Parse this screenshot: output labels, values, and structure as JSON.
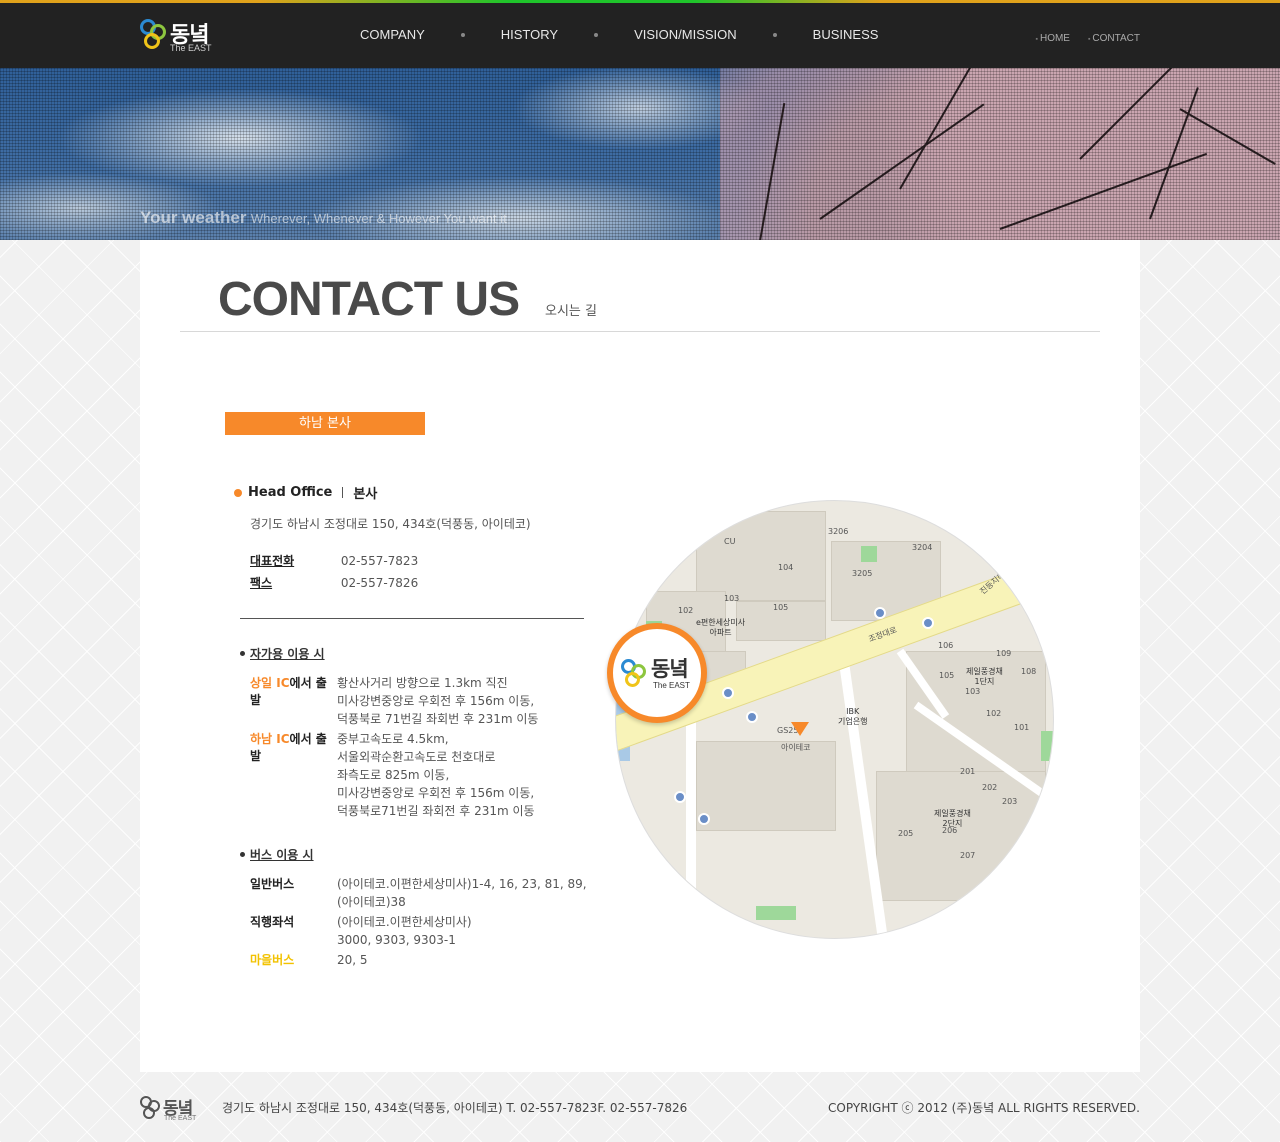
{
  "header": {
    "logo_kr": "동녘",
    "logo_en": "The EAST",
    "nav": [
      "COMPANY",
      "HISTORY",
      "VISION/MISSION",
      "BUSINESS"
    ],
    "util_nav": [
      "HOME",
      "CONTACT"
    ]
  },
  "banner": {
    "slogan_bold": "Your weather",
    "slogan_rest": "Wherever, Whenever & However You want it"
  },
  "page": {
    "title": "CONTACT US",
    "subtitle": "오시는 길",
    "office_tab": "하남 본사"
  },
  "head_office": {
    "title_en": "Head Office",
    "title_kr": "본사",
    "address": "경기도 하남시 조정대로 150, 434호(덕풍동, 아이테코)",
    "phone_label": "대표전화",
    "phone": "02-557-7823",
    "fax_label": "팩스",
    "fax": "02-557-7826"
  },
  "car": {
    "heading": "자가용 이용 시",
    "routes": [
      {
        "label_hl": "상일 IC",
        "label_rest": "에서 출발",
        "lines": [
          "황산사거리 방향으로 1.3km 직진",
          "미사강변중앙로 우회전 후 156m 이동,",
          "덕풍북로 71번길 좌회번 후 231m 이동"
        ]
      },
      {
        "label_hl": "하남 IC",
        "label_rest": "에서 출발",
        "lines": [
          "중부고속도로 4.5km,",
          "서울외곽순환고속도로 천호대로",
          "좌측도로 825m 이동,",
          "미사강변중앙로 우회전 후 156m 이동,",
          "덕풍북로71번길 좌회전 후 231m 이동"
        ]
      }
    ]
  },
  "bus": {
    "heading": "버스 이용 시",
    "routes": [
      {
        "label": "일반버스",
        "lines": [
          "(아이테코.이편한세상미사)1-4, 16, 23, 81, 89,",
          "(아이테코)38"
        ]
      },
      {
        "label": "직행좌석",
        "lines": [
          "(아이테코.이편한세상미사)",
          "3000, 9303, 9303-1"
        ]
      },
      {
        "label": "마을버스",
        "lines": [
          "20, 5"
        ]
      }
    ]
  },
  "map": {
    "labels": {
      "cu": "CU",
      "apt_e": "e편한세상미사\n아파트",
      "apt_j1": "제일풍경채\n1단지",
      "apt_j2": "제일풍경채\n2단지",
      "ibk": "IBK\n기업은행",
      "gs": "GS25",
      "itech": "아이테코",
      "road_jj": "조정대로",
      "road_jd": "진등지하차도",
      "n3206": "3206",
      "n3204": "3204",
      "n3205": "3205",
      "n104": "104",
      "n103": "103",
      "n102": "102",
      "n105": "105",
      "n101": "101",
      "n106": "106",
      "n109": "109",
      "n108": "108",
      "n105b": "105",
      "n103b": "103",
      "n102b": "102",
      "n101b": "101",
      "n201": "201",
      "n202": "202",
      "n203": "203",
      "n205": "205",
      "n206": "206",
      "n207": "207"
    },
    "pin_kr": "동녘",
    "pin_en": "The EAST"
  },
  "footer": {
    "logo_kr": "동녘",
    "logo_en": "The EAST",
    "address": "경기도 하남시 조정대로 150, 434호(덕풍동, 아이테코) T. 02-557-7823F. 02-557-7826",
    "copyright": "COPYRIGHT ⓒ 2012 (주)동녘 ALL RIGHTS RESERVED."
  },
  "colors": {
    "accent_orange": "#f7892a",
    "accent_yellow": "#f2c200",
    "topbar": "#222222"
  }
}
